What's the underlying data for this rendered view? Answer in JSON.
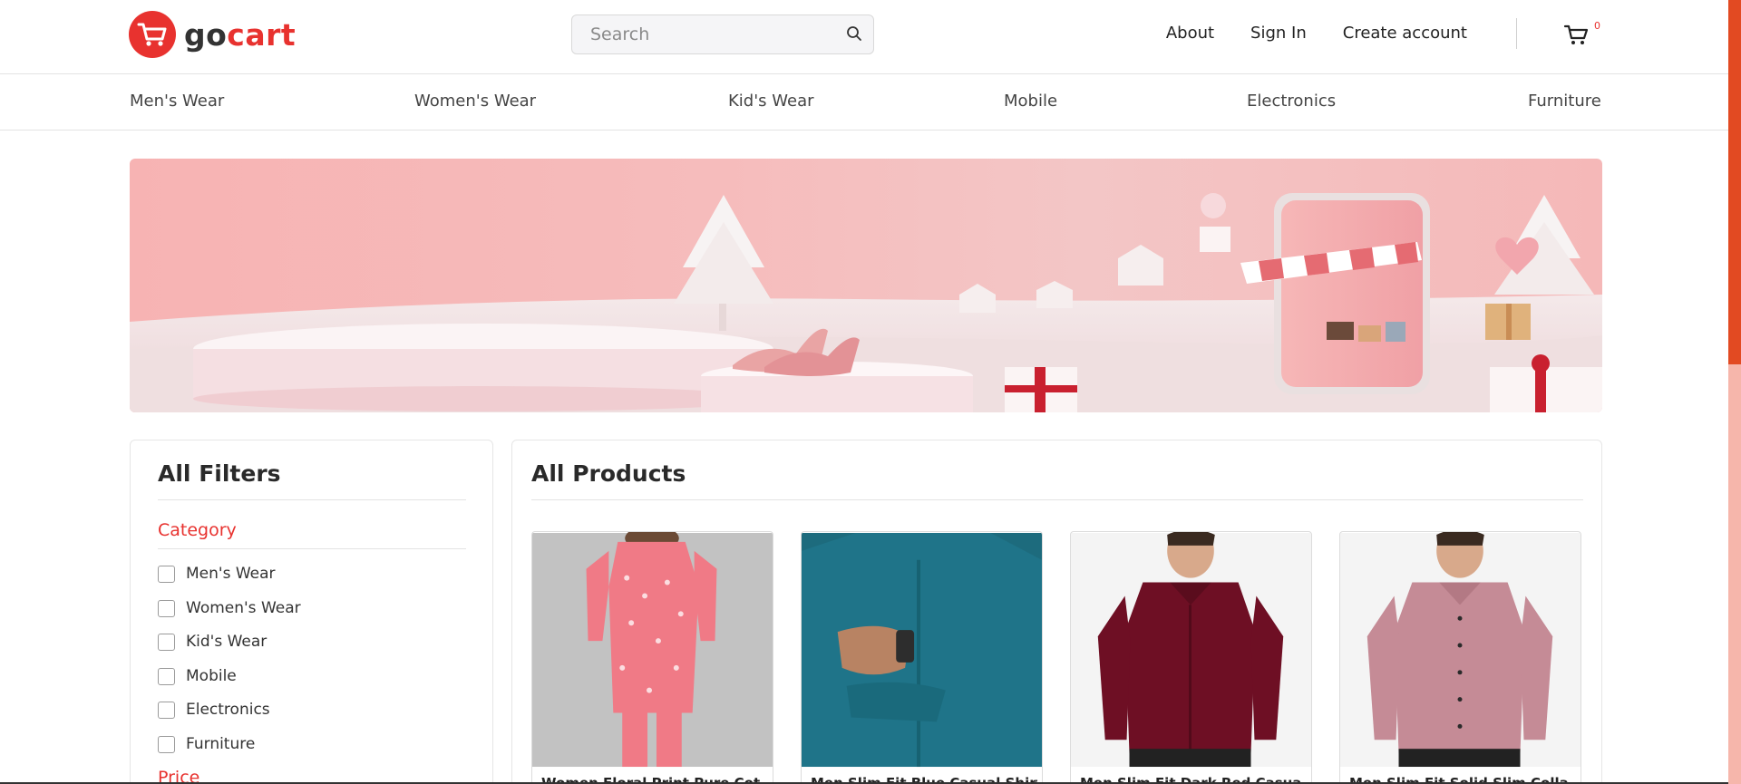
{
  "header": {
    "logo_go": "go",
    "logo_cart": "cart",
    "search_placeholder": "Search",
    "links": [
      "About",
      "Sign In",
      "Create account"
    ],
    "cart_count": "0",
    "brand_color": "#e8322f"
  },
  "categories": [
    "Men's Wear",
    "Women's Wear",
    "Kid's Wear",
    "Mobile",
    "Electronics",
    "Furniture"
  ],
  "banner": {
    "description_icon": "shopping-promo-banner"
  },
  "filters": {
    "title": "All Filters",
    "category_heading": "Category",
    "options": [
      "Men's Wear",
      "Women's Wear",
      "Kid's Wear",
      "Mobile",
      "Electronics",
      "Furniture"
    ],
    "price_heading": "Price"
  },
  "products": {
    "title": "All Products",
    "items": [
      {
        "title": "Women Floral Print Pure Cot"
      },
      {
        "title": "Men Slim Fit Blue Casual Shirt"
      },
      {
        "title": "Men Slim Fit Dark Red Casua"
      },
      {
        "title": "Men Slim Fit Solid Slim Colla"
      }
    ]
  }
}
